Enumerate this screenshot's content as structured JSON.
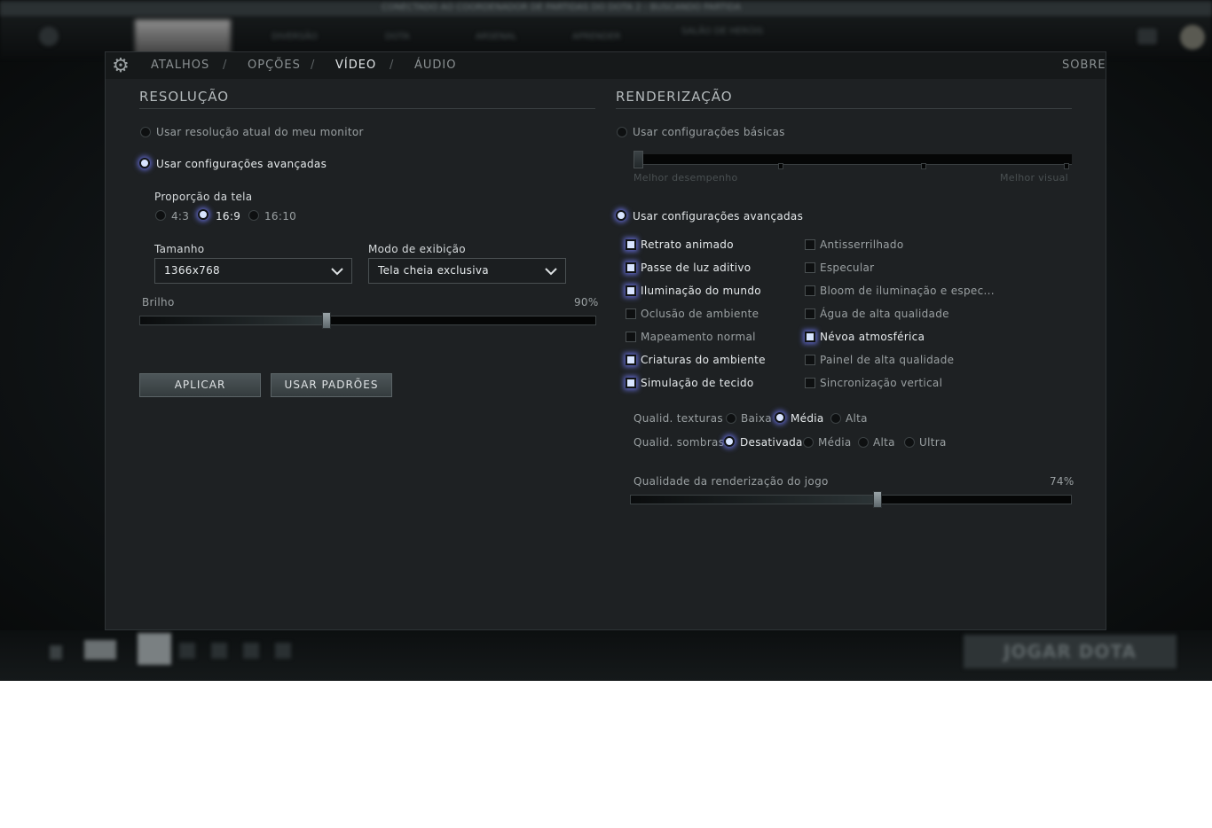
{
  "background": {
    "ticker": "CONECTADO AO COORDENADOR DE PARTIDAS DO DOTA 2 - BUSCANDO PARTIDA",
    "top_items": [
      "DIVERSÃO",
      "DOTA",
      "ARSENAL",
      "APRENDER",
      "SALÃO DE HERÓIS"
    ],
    "play_button": "JOGAR DOTA"
  },
  "nav": {
    "tabs": [
      "ATALHOS",
      "OPÇÕES",
      "VÍDEO",
      "ÁUDIO"
    ],
    "active_tab": "VÍDEO",
    "separator": "/",
    "about": "SOBRE"
  },
  "resolution": {
    "title": "RESOLUÇÃO",
    "use_monitor": "Usar resolução atual do meu monitor",
    "use_advanced": "Usar configurações avançadas",
    "aspect_label": "Proporção da tela",
    "aspect_options": [
      "4:3",
      "16:9",
      "16:10"
    ],
    "aspect_selected": "16:9",
    "size_label": "Tamanho",
    "size_value": "1366x768",
    "display_mode_label": "Modo de exibição",
    "display_mode_value": "Tela cheia exclusiva",
    "brightness_label": "Brilho",
    "brightness_value": "90%",
    "brightness_fraction": 0.41,
    "apply_button": "APLICAR",
    "defaults_button": "USAR PADRÕES"
  },
  "rendering": {
    "title": "RENDERIZAÇÃO",
    "use_basic": "Usar configurações básicas",
    "basic_left": "Melhor desempenho",
    "basic_right": "Melhor visual",
    "use_advanced": "Usar configurações avançadas",
    "options_left": [
      {
        "label": "Retrato animado",
        "checked": true
      },
      {
        "label": "Passe de luz aditivo",
        "checked": true
      },
      {
        "label": "Iluminação do mundo",
        "checked": true
      },
      {
        "label": "Oclusão de ambiente",
        "checked": false
      },
      {
        "label": "Mapeamento normal",
        "checked": false
      },
      {
        "label": "Criaturas do ambiente",
        "checked": true
      },
      {
        "label": "Simulação de tecido",
        "checked": true
      }
    ],
    "options_right": [
      {
        "label": "Antisserrilhado",
        "checked": false
      },
      {
        "label": "Especular",
        "checked": false
      },
      {
        "label": "Bloom de iluminação e espec...",
        "checked": false
      },
      {
        "label": "Água de alta qualidade",
        "checked": false
      },
      {
        "label": "Névoa atmosférica",
        "checked": true
      },
      {
        "label": "Painel de alta qualidade",
        "checked": false
      },
      {
        "label": "Sincronização vertical",
        "checked": false
      }
    ],
    "texture_label": "Qualid. texturas",
    "texture_options": [
      "Baixa",
      "Média",
      "Alta"
    ],
    "texture_selected": "Média",
    "shadow_label": "Qualid. sombras",
    "shadow_options": [
      "Desativada",
      "Média",
      "Alta",
      "Ultra"
    ],
    "shadow_selected": "Desativada",
    "render_quality_label": "Qualidade da renderização do jogo",
    "render_quality_value": "74%",
    "render_quality_fraction": 0.56
  },
  "colors": {
    "accent_glow": "#5f67c8",
    "panel_bg": "#1e2123"
  }
}
